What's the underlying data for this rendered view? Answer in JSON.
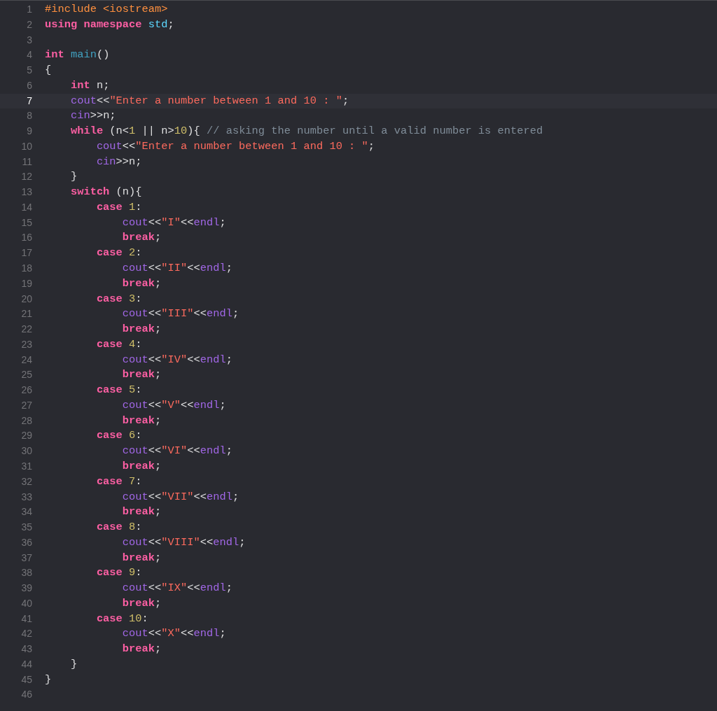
{
  "lines": [
    {
      "number": "1",
      "selected": false,
      "tokens": [
        {
          "kind": "preproc",
          "text": "#include <iostream>"
        }
      ]
    },
    {
      "number": "2",
      "selected": false,
      "tokens": [
        {
          "kind": "keyword",
          "text": "using namespace "
        },
        {
          "kind": "type",
          "text": "std"
        },
        {
          "kind": "plain",
          "text": ";"
        }
      ]
    },
    {
      "number": "3",
      "selected": false
    },
    {
      "number": "4",
      "selected": false,
      "tokens": [
        {
          "kind": "keyword",
          "text": "int "
        },
        {
          "kind": "function",
          "text": "main"
        },
        {
          "kind": "plain",
          "text": "()"
        }
      ]
    },
    {
      "number": "5",
      "selected": false,
      "tokens": [
        {
          "kind": "plain",
          "text": "{"
        }
      ]
    },
    {
      "number": "6",
      "selected": false,
      "tokens": [
        {
          "kind": "keyword",
          "text": "    int"
        },
        {
          "kind": "plain",
          "text": " n;"
        }
      ]
    },
    {
      "number": "7",
      "selected": true,
      "tokens": [
        {
          "kind": "library",
          "text": "    cout"
        },
        {
          "kind": "plain",
          "text": "<<"
        },
        {
          "kind": "string",
          "text": "\"Enter a number between 1 and 10 : \""
        },
        {
          "kind": "plain",
          "text": ";"
        }
      ]
    },
    {
      "number": "8",
      "selected": false,
      "tokens": [
        {
          "kind": "library",
          "text": "    cin"
        },
        {
          "kind": "plain",
          "text": ">>n;"
        }
      ]
    },
    {
      "number": "9",
      "selected": false,
      "tokens": [
        {
          "kind": "keyword",
          "text": "    while"
        },
        {
          "kind": "plain",
          "text": " (n<"
        },
        {
          "kind": "number",
          "text": "1"
        },
        {
          "kind": "plain",
          "text": " || n>"
        },
        {
          "kind": "number",
          "text": "10"
        },
        {
          "kind": "plain",
          "text": "){ "
        },
        {
          "kind": "comment",
          "text": "// asking the number until a valid number is entered"
        }
      ]
    },
    {
      "number": "10",
      "selected": false,
      "tokens": [
        {
          "kind": "library",
          "text": "        cout"
        },
        {
          "kind": "plain",
          "text": "<<"
        },
        {
          "kind": "string",
          "text": "\"Enter a number between 1 and 10 : \""
        },
        {
          "kind": "plain",
          "text": ";"
        }
      ]
    },
    {
      "number": "11",
      "selected": false,
      "tokens": [
        {
          "kind": "library",
          "text": "        cin"
        },
        {
          "kind": "plain",
          "text": ">>n;"
        }
      ]
    },
    {
      "number": "12",
      "selected": false,
      "tokens": [
        {
          "kind": "plain",
          "text": "    }"
        }
      ]
    },
    {
      "number": "13",
      "selected": false,
      "tokens": [
        {
          "kind": "keyword",
          "text": "    switch"
        },
        {
          "kind": "plain",
          "text": " (n){"
        }
      ]
    },
    {
      "number": "14",
      "selected": false,
      "tokens": [
        {
          "kind": "keyword",
          "text": "        case "
        },
        {
          "kind": "number",
          "text": "1"
        },
        {
          "kind": "plain",
          "text": ":"
        }
      ]
    },
    {
      "number": "15",
      "selected": false,
      "tokens": [
        {
          "kind": "library",
          "text": "            cout"
        },
        {
          "kind": "plain",
          "text": "<<"
        },
        {
          "kind": "string",
          "text": "\"I\""
        },
        {
          "kind": "plain",
          "text": "<<"
        },
        {
          "kind": "library",
          "text": "endl"
        },
        {
          "kind": "plain",
          "text": ";"
        }
      ]
    },
    {
      "number": "16",
      "selected": false,
      "tokens": [
        {
          "kind": "keyword",
          "text": "            break"
        },
        {
          "kind": "plain",
          "text": ";"
        }
      ]
    },
    {
      "number": "17",
      "selected": false,
      "tokens": [
        {
          "kind": "keyword",
          "text": "        case "
        },
        {
          "kind": "number",
          "text": "2"
        },
        {
          "kind": "plain",
          "text": ":"
        }
      ]
    },
    {
      "number": "18",
      "selected": false,
      "tokens": [
        {
          "kind": "library",
          "text": "            cout"
        },
        {
          "kind": "plain",
          "text": "<<"
        },
        {
          "kind": "string",
          "text": "\"II\""
        },
        {
          "kind": "plain",
          "text": "<<"
        },
        {
          "kind": "library",
          "text": "endl"
        },
        {
          "kind": "plain",
          "text": ";"
        }
      ]
    },
    {
      "number": "19",
      "selected": false,
      "tokens": [
        {
          "kind": "keyword",
          "text": "            break"
        },
        {
          "kind": "plain",
          "text": ";"
        }
      ]
    },
    {
      "number": "20",
      "selected": false,
      "tokens": [
        {
          "kind": "keyword",
          "text": "        case "
        },
        {
          "kind": "number",
          "text": "3"
        },
        {
          "kind": "plain",
          "text": ":"
        }
      ]
    },
    {
      "number": "21",
      "selected": false,
      "tokens": [
        {
          "kind": "library",
          "text": "            cout"
        },
        {
          "kind": "plain",
          "text": "<<"
        },
        {
          "kind": "string",
          "text": "\"III\""
        },
        {
          "kind": "plain",
          "text": "<<"
        },
        {
          "kind": "library",
          "text": "endl"
        },
        {
          "kind": "plain",
          "text": ";"
        }
      ]
    },
    {
      "number": "22",
      "selected": false,
      "tokens": [
        {
          "kind": "keyword",
          "text": "            break"
        },
        {
          "kind": "plain",
          "text": ";"
        }
      ]
    },
    {
      "number": "23",
      "selected": false,
      "tokens": [
        {
          "kind": "keyword",
          "text": "        case "
        },
        {
          "kind": "number",
          "text": "4"
        },
        {
          "kind": "plain",
          "text": ":"
        }
      ]
    },
    {
      "number": "24",
      "selected": false,
      "tokens": [
        {
          "kind": "library",
          "text": "            cout"
        },
        {
          "kind": "plain",
          "text": "<<"
        },
        {
          "kind": "string",
          "text": "\"IV\""
        },
        {
          "kind": "plain",
          "text": "<<"
        },
        {
          "kind": "library",
          "text": "endl"
        },
        {
          "kind": "plain",
          "text": ";"
        }
      ]
    },
    {
      "number": "25",
      "selected": false,
      "tokens": [
        {
          "kind": "keyword",
          "text": "            break"
        },
        {
          "kind": "plain",
          "text": ";"
        }
      ]
    },
    {
      "number": "26",
      "selected": false,
      "tokens": [
        {
          "kind": "keyword",
          "text": "        case "
        },
        {
          "kind": "number",
          "text": "5"
        },
        {
          "kind": "plain",
          "text": ":"
        }
      ]
    },
    {
      "number": "27",
      "selected": false,
      "tokens": [
        {
          "kind": "library",
          "text": "            cout"
        },
        {
          "kind": "plain",
          "text": "<<"
        },
        {
          "kind": "string",
          "text": "\"V\""
        },
        {
          "kind": "plain",
          "text": "<<"
        },
        {
          "kind": "library",
          "text": "endl"
        },
        {
          "kind": "plain",
          "text": ";"
        }
      ]
    },
    {
      "number": "28",
      "selected": false,
      "tokens": [
        {
          "kind": "keyword",
          "text": "            break"
        },
        {
          "kind": "plain",
          "text": ";"
        }
      ]
    },
    {
      "number": "29",
      "selected": false,
      "tokens": [
        {
          "kind": "keyword",
          "text": "        case "
        },
        {
          "kind": "number",
          "text": "6"
        },
        {
          "kind": "plain",
          "text": ":"
        }
      ]
    },
    {
      "number": "30",
      "selected": false,
      "tokens": [
        {
          "kind": "library",
          "text": "            cout"
        },
        {
          "kind": "plain",
          "text": "<<"
        },
        {
          "kind": "string",
          "text": "\"VI\""
        },
        {
          "kind": "plain",
          "text": "<<"
        },
        {
          "kind": "library",
          "text": "endl"
        },
        {
          "kind": "plain",
          "text": ";"
        }
      ]
    },
    {
      "number": "31",
      "selected": false,
      "tokens": [
        {
          "kind": "keyword",
          "text": "            break"
        },
        {
          "kind": "plain",
          "text": ";"
        }
      ]
    },
    {
      "number": "32",
      "selected": false,
      "tokens": [
        {
          "kind": "keyword",
          "text": "        case "
        },
        {
          "kind": "number",
          "text": "7"
        },
        {
          "kind": "plain",
          "text": ":"
        }
      ]
    },
    {
      "number": "33",
      "selected": false,
      "tokens": [
        {
          "kind": "library",
          "text": "            cout"
        },
        {
          "kind": "plain",
          "text": "<<"
        },
        {
          "kind": "string",
          "text": "\"VII\""
        },
        {
          "kind": "plain",
          "text": "<<"
        },
        {
          "kind": "library",
          "text": "endl"
        },
        {
          "kind": "plain",
          "text": ";"
        }
      ]
    },
    {
      "number": "34",
      "selected": false,
      "tokens": [
        {
          "kind": "keyword",
          "text": "            break"
        },
        {
          "kind": "plain",
          "text": ";"
        }
      ]
    },
    {
      "number": "35",
      "selected": false,
      "tokens": [
        {
          "kind": "keyword",
          "text": "        case "
        },
        {
          "kind": "number",
          "text": "8"
        },
        {
          "kind": "plain",
          "text": ":"
        }
      ]
    },
    {
      "number": "36",
      "selected": false,
      "tokens": [
        {
          "kind": "library",
          "text": "            cout"
        },
        {
          "kind": "plain",
          "text": "<<"
        },
        {
          "kind": "string",
          "text": "\"VIII\""
        },
        {
          "kind": "plain",
          "text": "<<"
        },
        {
          "kind": "library",
          "text": "endl"
        },
        {
          "kind": "plain",
          "text": ";"
        }
      ]
    },
    {
      "number": "37",
      "selected": false,
      "tokens": [
        {
          "kind": "keyword",
          "text": "            break"
        },
        {
          "kind": "plain",
          "text": ";"
        }
      ]
    },
    {
      "number": "38",
      "selected": false,
      "tokens": [
        {
          "kind": "keyword",
          "text": "        case "
        },
        {
          "kind": "number",
          "text": "9"
        },
        {
          "kind": "plain",
          "text": ":"
        }
      ]
    },
    {
      "number": "39",
      "selected": false,
      "tokens": [
        {
          "kind": "library",
          "text": "            cout"
        },
        {
          "kind": "plain",
          "text": "<<"
        },
        {
          "kind": "string",
          "text": "\"IX\""
        },
        {
          "kind": "plain",
          "text": "<<"
        },
        {
          "kind": "library",
          "text": "endl"
        },
        {
          "kind": "plain",
          "text": ";"
        }
      ]
    },
    {
      "number": "40",
      "selected": false,
      "tokens": [
        {
          "kind": "keyword",
          "text": "            break"
        },
        {
          "kind": "plain",
          "text": ";"
        }
      ]
    },
    {
      "number": "41",
      "selected": false,
      "tokens": [
        {
          "kind": "keyword",
          "text": "        case "
        },
        {
          "kind": "number",
          "text": "10"
        },
        {
          "kind": "plain",
          "text": ":"
        }
      ]
    },
    {
      "number": "42",
      "selected": false,
      "tokens": [
        {
          "kind": "library",
          "text": "            cout"
        },
        {
          "kind": "plain",
          "text": "<<"
        },
        {
          "kind": "string",
          "text": "\"X\""
        },
        {
          "kind": "plain",
          "text": "<<"
        },
        {
          "kind": "library",
          "text": "endl"
        },
        {
          "kind": "plain",
          "text": ";"
        }
      ]
    },
    {
      "number": "43",
      "selected": false,
      "tokens": [
        {
          "kind": "keyword",
          "text": "            break"
        },
        {
          "kind": "plain",
          "text": ";"
        }
      ]
    },
    {
      "number": "44",
      "selected": false,
      "tokens": [
        {
          "kind": "plain",
          "text": "    }"
        }
      ]
    },
    {
      "number": "45",
      "selected": false,
      "tokens": [
        {
          "kind": "plain",
          "text": "}"
        }
      ]
    },
    {
      "number": "46",
      "selected": false
    }
  ]
}
